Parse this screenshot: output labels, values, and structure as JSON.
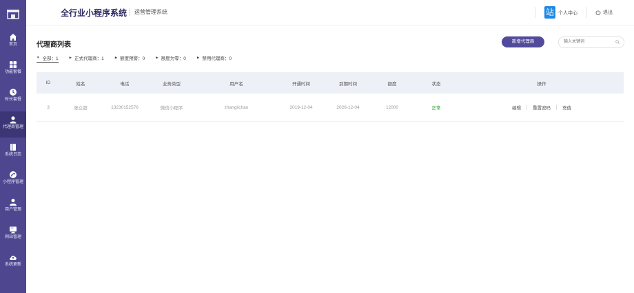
{
  "app": {
    "brand_title": "全行业小程序系统",
    "brand_subtitle": "运营管理系统"
  },
  "header": {
    "user_icon_text": "站",
    "user_label": "个人中心",
    "logout_label": "退出"
  },
  "sidebar": {
    "items": [
      {
        "label": "首页",
        "icon": "home-icon"
      },
      {
        "label": "功能套餐",
        "icon": "grid-icon"
      },
      {
        "label": "时长套餐",
        "icon": "clock-icon"
      },
      {
        "label": "代理商管理",
        "icon": "agent-icon",
        "active": true
      },
      {
        "label": "系统日志",
        "icon": "log-book-icon"
      },
      {
        "label": "小程序管理",
        "icon": "mini-program-icon"
      },
      {
        "label": "用户管理",
        "icon": "users-icon"
      },
      {
        "label": "网站管理",
        "icon": "website-icon"
      },
      {
        "label": "系统更新",
        "icon": "cloud-update-icon"
      }
    ]
  },
  "main": {
    "title": "代理商列表",
    "add_button": "新增代理商",
    "search_placeholder": "输入关键词",
    "filters": [
      {
        "label": "全部：1",
        "active": true
      },
      {
        "label": "正式代理商：1"
      },
      {
        "label": "额度预警：0"
      },
      {
        "label": "额度为零：0"
      },
      {
        "label": "禁用代理商：0"
      }
    ],
    "table": {
      "headers": {
        "id": "ID",
        "name": "姓名",
        "phone": "电话",
        "business": "业务类型",
        "username": "用户名",
        "open_time": "开通时间",
        "expire_time": "到期时间",
        "quota": "额度",
        "status": "状态",
        "actions": "操作"
      },
      "rows": [
        {
          "id": "3",
          "name": "张立超",
          "phone": "13230152576",
          "business": "微信小程序",
          "username": "zhanglichao",
          "open_time": "2019-12-04",
          "expire_time": "2026-12-04",
          "quota": "12000",
          "status": "正常",
          "actions": [
            "编辑",
            "重置密码",
            "充值"
          ]
        }
      ]
    }
  },
  "colors": {
    "sidebar_bg": "#4e4790",
    "accent": "#524a9b",
    "table_header_bg": "#eef0f8",
    "status_ok": "#2a9b2a"
  }
}
